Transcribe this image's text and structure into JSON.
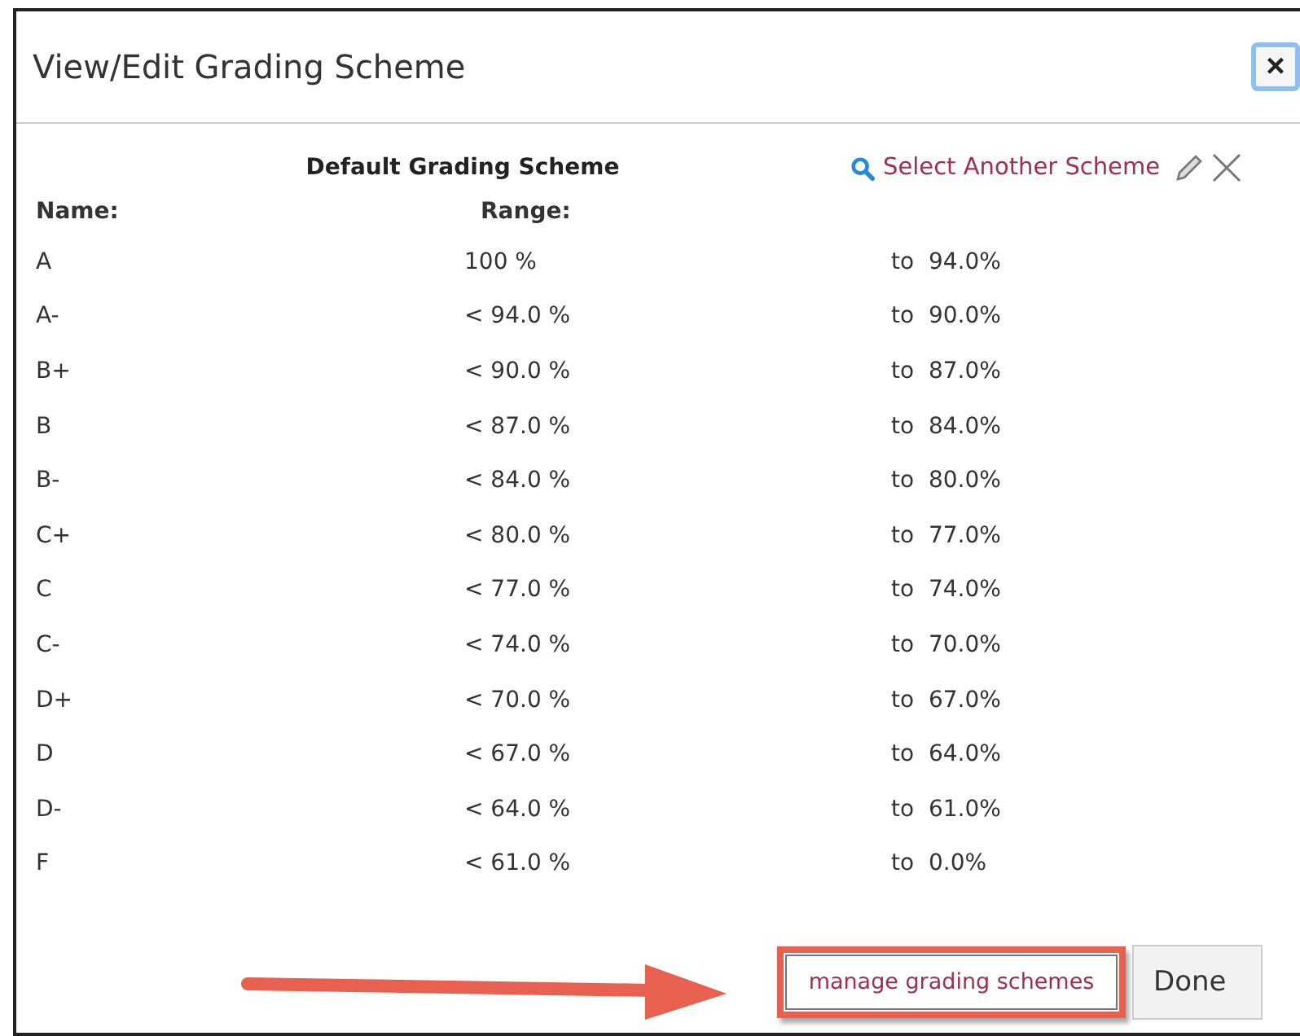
{
  "dialog": {
    "title": "View/Edit Grading Scheme",
    "close": "×"
  },
  "scheme": {
    "title": "Default Grading Scheme",
    "select_link": "Select Another Scheme"
  },
  "columns": {
    "name": "Name:",
    "range": "Range:"
  },
  "rows": [
    {
      "name": "A",
      "upper": "100 %",
      "lower": "to  94.0%"
    },
    {
      "name": "A-",
      "upper": "< 94.0 %",
      "lower": "to  90.0%"
    },
    {
      "name": "B+",
      "upper": "< 90.0 %",
      "lower": "to  87.0%"
    },
    {
      "name": "B",
      "upper": "< 87.0 %",
      "lower": "to  84.0%"
    },
    {
      "name": "B-",
      "upper": "< 84.0 %",
      "lower": "to  80.0%"
    },
    {
      "name": "C+",
      "upper": "< 80.0 %",
      "lower": "to  77.0%"
    },
    {
      "name": "C",
      "upper": "< 77.0 %",
      "lower": "to  74.0%"
    },
    {
      "name": "C-",
      "upper": "< 74.0 %",
      "lower": "to  70.0%"
    },
    {
      "name": "D+",
      "upper": "< 70.0 %",
      "lower": "to  67.0%"
    },
    {
      "name": "D",
      "upper": "< 67.0 %",
      "lower": "to  64.0%"
    },
    {
      "name": "D-",
      "upper": "< 64.0 %",
      "lower": "to  61.0%"
    },
    {
      "name": "F",
      "upper": "< 61.0 %",
      "lower": "to  0.0%"
    }
  ],
  "footer": {
    "manage_link": "manage grading schemes",
    "done_button": "Done"
  }
}
